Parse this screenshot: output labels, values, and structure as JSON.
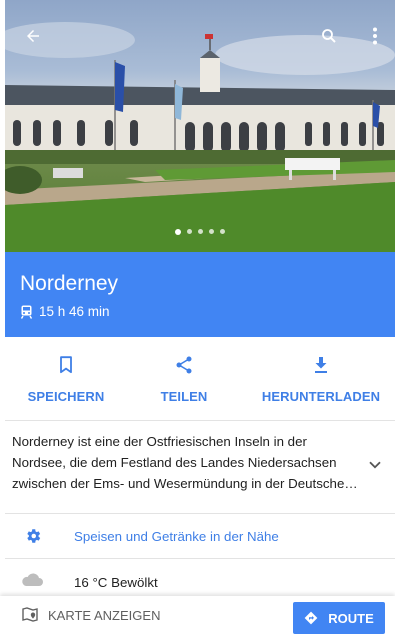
{
  "hero": {
    "photo_count": 5,
    "active_photo_index": 0,
    "icons": {
      "back": "arrow-left-icon",
      "search": "search-icon",
      "more": "more-vert-icon"
    }
  },
  "place": {
    "title": "Norderney",
    "travel_mode_icon": "train-icon",
    "travel_time": "15 h 46 min"
  },
  "actions": [
    {
      "label": "SPEICHERN",
      "icon": "bookmark-icon"
    },
    {
      "label": "TEILEN",
      "icon": "share-icon"
    },
    {
      "label": "HERUNTERLADEN",
      "icon": "download-icon"
    }
  ],
  "description": {
    "text": "Norderney ist eine der Ostfriesischen Inseln in der Nordsee, die dem Festland des Landes Niedersachsen zwischen der Ems- und Wesermündung in der Deutsche…",
    "expand_icon": "chevron-down-icon"
  },
  "nearby": {
    "label": "Speisen und Getränke in der Nähe",
    "icon": "gear-icon"
  },
  "weather": {
    "label": "16 °C Bewölkt",
    "icon": "cloud-icon"
  },
  "bottom_bar": {
    "map_label": "KARTE ANZEIGEN",
    "map_icon": "map-pin-icon",
    "route_label": "ROUTE",
    "route_icon": "directions-icon"
  },
  "colors": {
    "accent": "#4185f3",
    "link": "#3f7fe6",
    "divider": "#e3e3e3"
  }
}
